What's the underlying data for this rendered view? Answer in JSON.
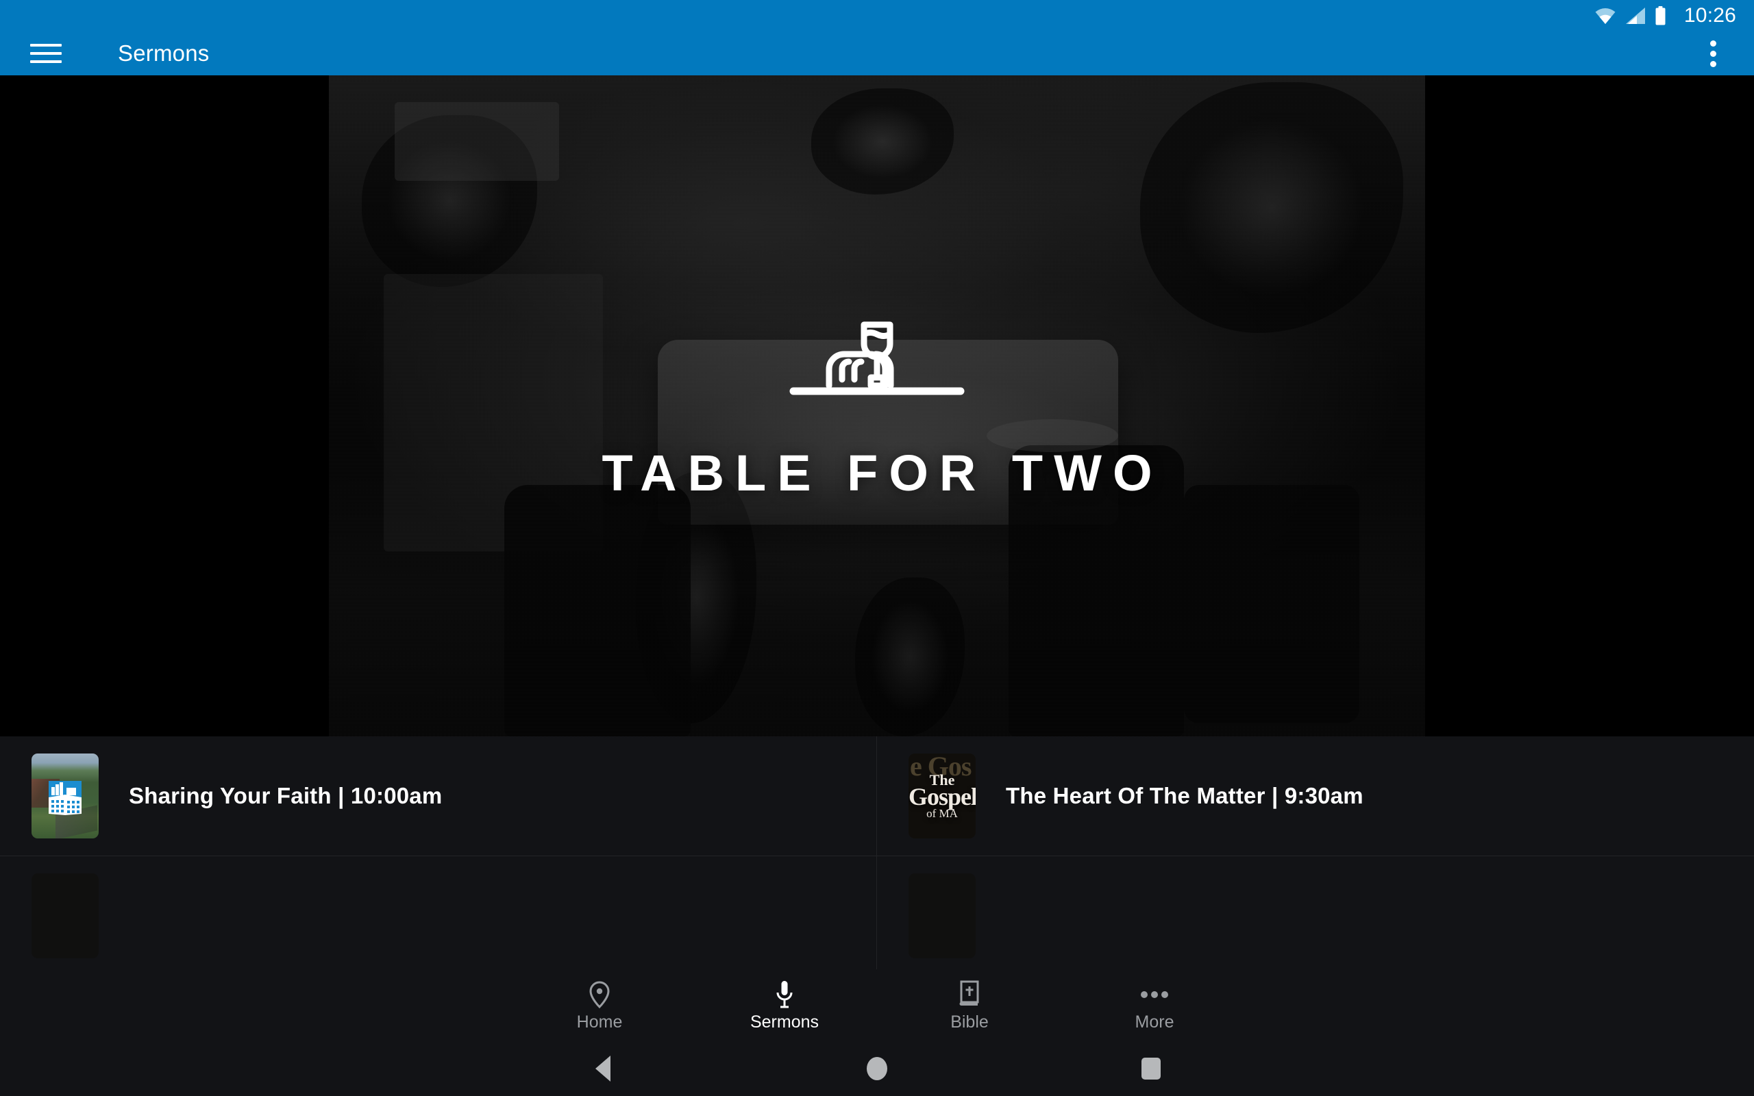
{
  "status_bar": {
    "time": "10:26",
    "icons": [
      "wifi-icon",
      "cellular-signal-icon",
      "battery-icon"
    ]
  },
  "app_bar": {
    "menu_icon": "hamburger-menu-icon",
    "title": "Sermons",
    "overflow_icon": "overflow-menu-icon",
    "background_color": "#0279be"
  },
  "hero": {
    "title": "TABLE FOR TWO",
    "logo_icon": "bread-and-wine-table-logo",
    "background_description": "living room with sofa, chairs and plants, darkened grayscale photo"
  },
  "sermons": [
    {
      "title": "Sharing Your Faith | 10:00am",
      "thumbnail": "aerial-campus-photo-with-building-badge"
    },
    {
      "title": "The Heart Of The Matter | 9:30am",
      "thumbnail": "the-gospel-of-mark-artwork",
      "artwork": {
        "line1": "The",
        "line2": "Gospel",
        "line3": "of MA",
        "backdrop": "e Gos"
      }
    },
    {
      "title": "",
      "thumbnail": "partially-visible-artwork"
    },
    {
      "title": "",
      "thumbnail": "partially-visible-artwork"
    }
  ],
  "bottom_nav": {
    "items": [
      {
        "label": "Home",
        "icon": "location-pin-icon",
        "active": false
      },
      {
        "label": "Sermons",
        "icon": "microphone-icon",
        "active": true
      },
      {
        "label": "Bible",
        "icon": "bible-book-icon",
        "active": false
      },
      {
        "label": "More",
        "icon": "more-dots-icon",
        "active": false
      }
    ],
    "active_color": "#ffffff",
    "inactive_color": "#9a9da1"
  },
  "system_nav": {
    "back": "back-triangle-icon",
    "home": "home-circle-icon",
    "recents": "recents-square-icon"
  },
  "theme": {
    "accent": "#0279be",
    "surface": "#121316",
    "divider": "#222326"
  }
}
